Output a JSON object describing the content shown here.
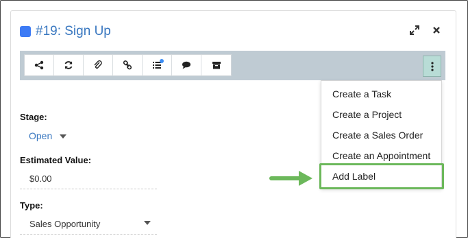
{
  "header": {
    "title": "#19: Sign Up",
    "title_color": "#3a78c0",
    "square_color": "#3d7bf5",
    "expand_icon": "expand-icon",
    "close_icon": "close-icon"
  },
  "toolbar": {
    "background": "#bfcbd3",
    "buttons": [
      {
        "icon": "share-icon"
      },
      {
        "icon": "refresh-icon"
      },
      {
        "icon": "paperclip-icon"
      },
      {
        "icon": "link-icon"
      },
      {
        "icon": "list-icon"
      },
      {
        "icon": "comments-icon"
      },
      {
        "icon": "archive-icon"
      }
    ],
    "more_icon": "more-vertical-icon"
  },
  "menu": {
    "items": [
      "Create a Task",
      "Create a Project",
      "Create a Sales Order",
      "Create an Appointment",
      "Add Label"
    ],
    "highlight_color": "#6cb85b"
  },
  "fields": {
    "stage_label": "Stage:",
    "stage_value": "Open",
    "estimated_label": "Estimated Value:",
    "estimated_value": "$0.00",
    "type_label": "Type:",
    "type_value": "Sales Opportunity"
  }
}
